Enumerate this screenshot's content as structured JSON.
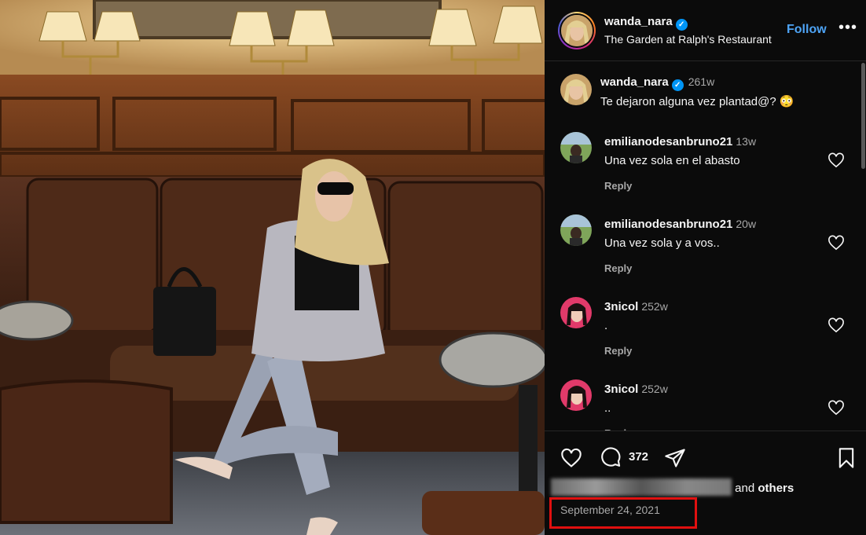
{
  "post": {
    "username": "wanda_nara",
    "location": "The Garden at Ralph's Restaurant",
    "follow_label": "Follow",
    "more_label": "•••",
    "verified_mark": "✓"
  },
  "caption": {
    "username": "wanda_nara",
    "time": "261w",
    "text": "Te dejaron alguna vez plantad@? 😳"
  },
  "comments": [
    {
      "username": "emilianodesanbruno21",
      "time": "13w",
      "text": "Una vez sola en el abasto",
      "reply_label": "Reply"
    },
    {
      "username": "emilianodesanbruno21",
      "time": "20w",
      "text": "Una vez sola y a vos..",
      "reply_label": "Reply"
    },
    {
      "username": "3nicol",
      "time": "252w",
      "text": ".",
      "reply_label": "Reply"
    },
    {
      "username": "3nicol",
      "time": "252w",
      "text": "..",
      "reply_label": "Reply"
    }
  ],
  "actions": {
    "comment_count": "372",
    "likes_suffix": "and",
    "likes_others": "others",
    "date": "September 24, 2021"
  },
  "icons": [
    "verified-badge-icon",
    "more-icon",
    "heart-icon",
    "comment-icon",
    "share-icon",
    "bookmark-icon"
  ],
  "colors": {
    "accent_blue": "#4ea4f5",
    "verified_blue": "#0095f6",
    "highlight_red": "#e01010",
    "panel_bg": "#0b0b0b"
  }
}
